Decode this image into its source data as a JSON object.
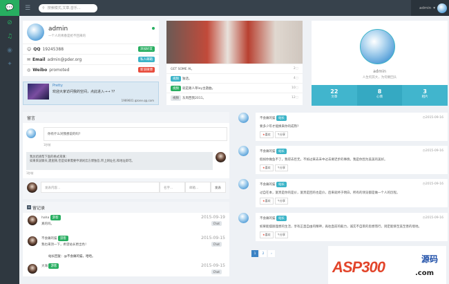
{
  "header": {
    "search_placeholder": "搜索模式,文章,音乐...",
    "user": "admin"
  },
  "profile": {
    "name": "admin",
    "motto": "一个人的青春是抢不回来的",
    "rows": [
      {
        "key": "QQ",
        "value": "19245388",
        "badge": "添加好友"
      },
      {
        "key": "Email",
        "value": "admin@pder.org",
        "badge": "私人邮箱"
      },
      {
        "key": "Weibo",
        "value": "promoted",
        "badge": "新浪微博"
      }
    ]
  },
  "shout": {
    "name": "Pretty",
    "text": "欢迎大家访问我的空间，点此进入→→ ??",
    "link": "1969601.qzone.qq.com"
  },
  "gallery": {
    "items": [
      {
        "tag": "",
        "title": "GET SOME AI。",
        "count": "2"
      },
      {
        "tag": "视频",
        "title": "独话。",
        "count": "4"
      },
      {
        "tag": "视频",
        "title": "就是路人草ley主题曲。",
        "count": "10"
      },
      {
        "tag": "视频",
        "title": "东周西我2011。",
        "count": "12"
      }
    ]
  },
  "card": {
    "name": "admin",
    "motto": "人生何其大，为何要回头",
    "stats": [
      {
        "value": "22",
        "label": "文章"
      },
      {
        "value": "8",
        "label": "心情"
      },
      {
        "value": "3",
        "label": "相片"
      }
    ]
  },
  "guestbook": {
    "title": "留言",
    "q": "你有什么对我想说的吗?",
    "q_time": "1秒前",
    "reply": "我总结挑帮下面的格式来填：\n如果来说聊天,建屋顾,但是如果需要申请闲云方博独答,带上网址名,和地址即可。",
    "reply_time": "1秒前",
    "input_placeholder": "发表内容...",
    "name_placeholder": "名字...",
    "email_placeholder": "邮箱...",
    "send": "发表"
  },
  "records": {
    "title": "留记录",
    "items": [
      {
        "name": "haha",
        "badge": "游客",
        "text": "真的吗。",
        "date": "2015-09-19",
        "tag": "Chat"
      },
      {
        "name": "不会痛的猫",
        "badge": "游客",
        "text": "我也来顶一下，希望站长更出色！",
        "reply": "站长回复：@不会痛的猫，哈哈。",
        "date": "2015-09-15",
        "tag": "Chat"
      },
      {
        "name": "大海",
        "badge": "游客",
        "text": "",
        "date": "2015-09-15",
        "tag": "Chat"
      }
    ]
  },
  "timeline": [
    {
      "name": "不会痛的猫",
      "badge": "站长",
      "date": "2015-09-16",
      "text": "要多少年才能换来你的成熟?",
      "like": "喜欢",
      "share": "分享"
    },
    {
      "name": "不会痛的猫",
      "badge": "站长",
      "date": "2015-09-16",
      "text": "假如你做鱼不了，我得去巨无，不如过来去未中过去要迟步的事情，我是你因为美美的美好。",
      "like": "喜欢",
      "share": "分享"
    },
    {
      "name": "不会痛的猫",
      "badge": "站长",
      "date": "2015-09-16",
      "text": "过自在本，富贵是你的是价，富贵是回的也是价，后来就终于明白，所有的领览都是做一个人的历程。",
      "like": "喜欢",
      "share": "分享"
    },
    {
      "name": "不会痛的猫",
      "badge": "站长",
      "date": "2015-09-16",
      "text": "如果能摆脱理想的生活，享有正直自由的精神，再往直前的毅力，诚实不自欺的思想而行，则定能够至美至善的境地。",
      "like": "喜欢",
      "share": "分享"
    }
  ],
  "pagination": [
    "1",
    "2",
    "›"
  ],
  "ad": {
    "text": "ASP300",
    "cn": "源码",
    "domain": ".com"
  }
}
